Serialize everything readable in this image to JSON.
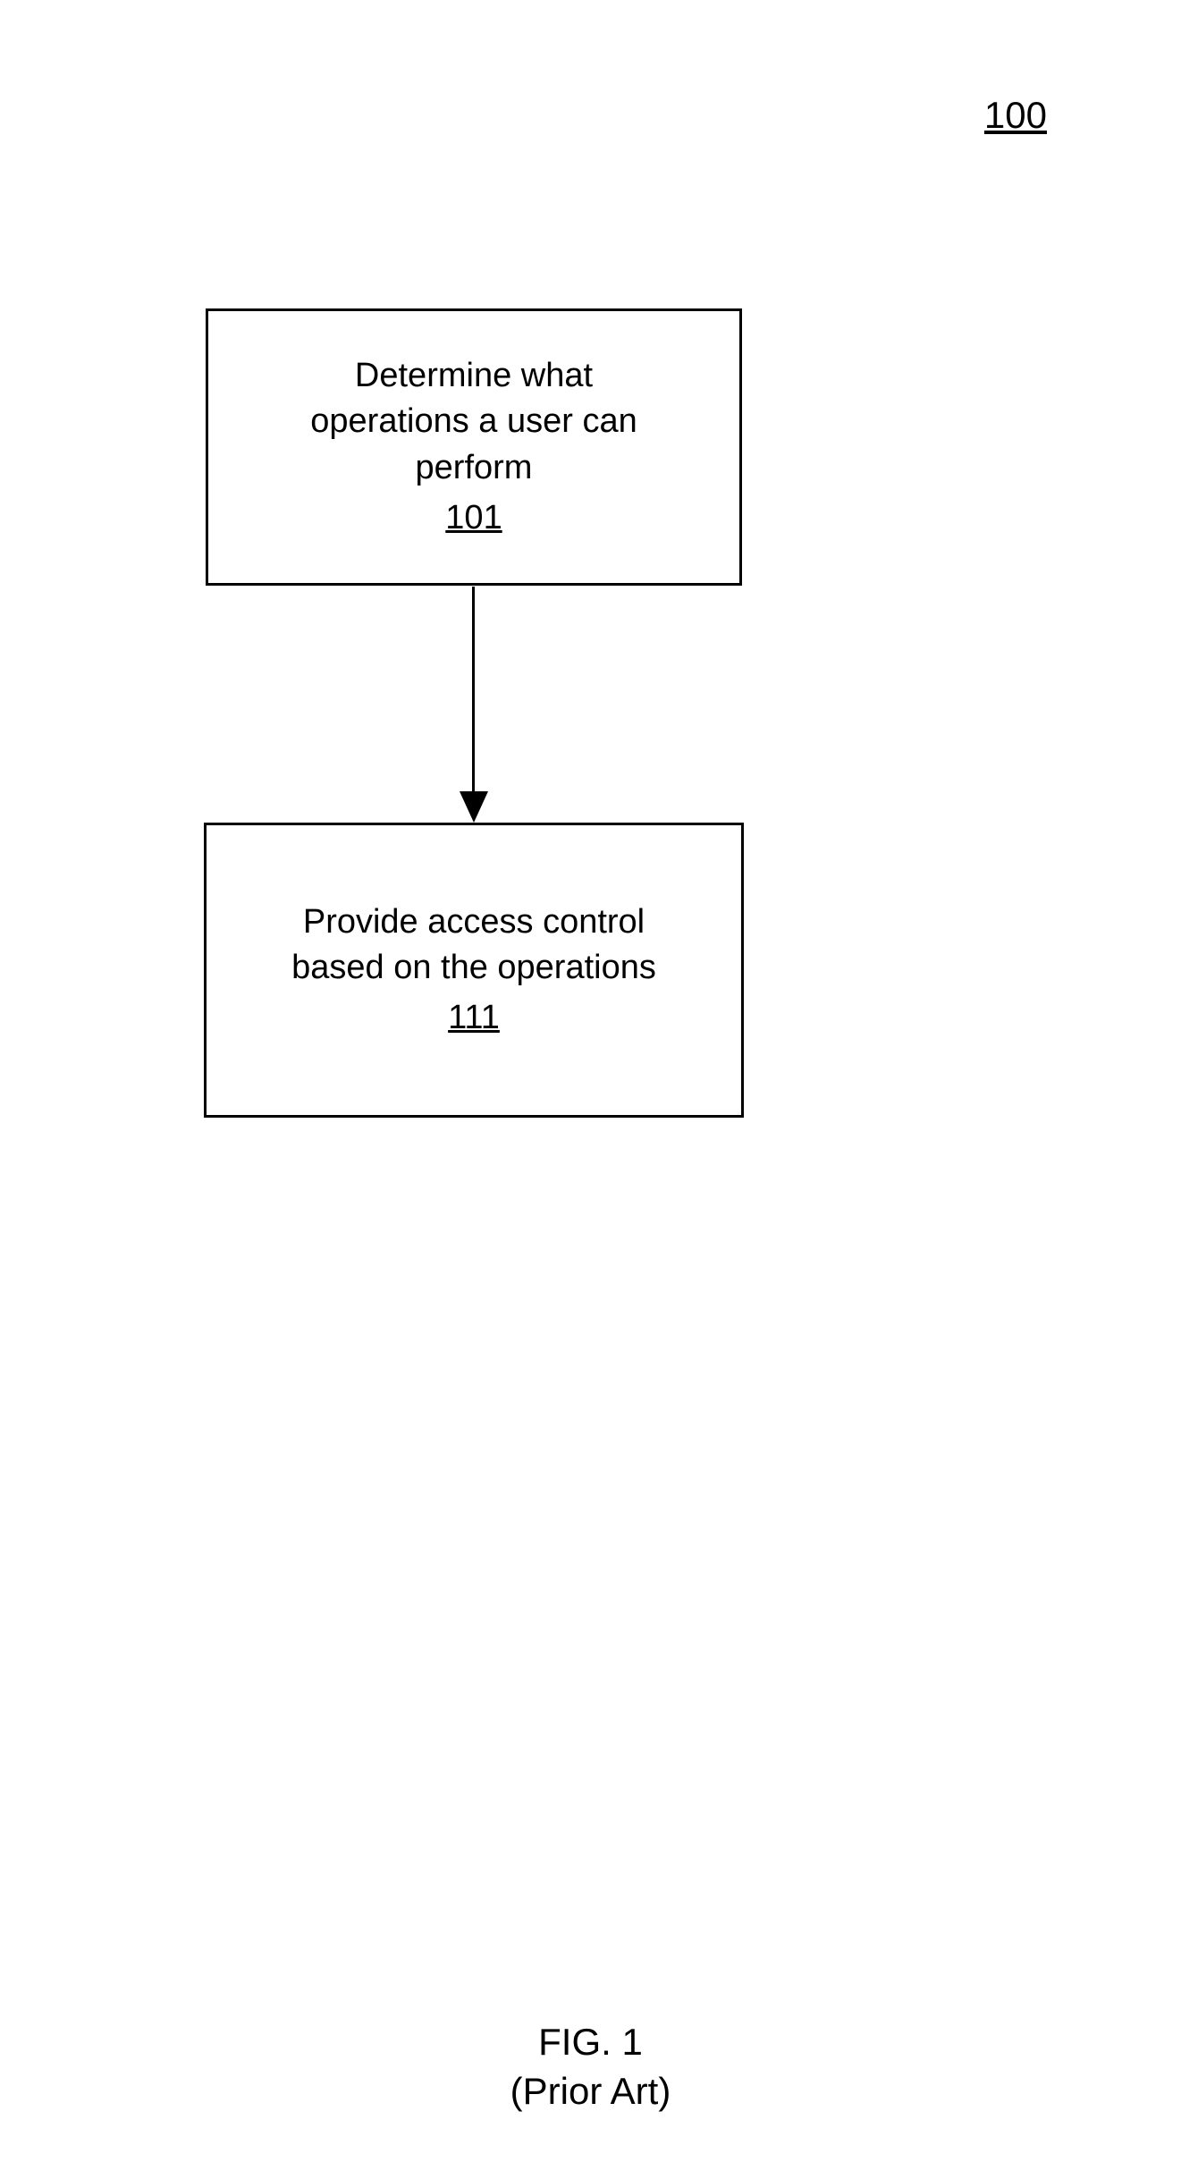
{
  "figure_number": "100",
  "box101": {
    "text": "Determine what\noperations a user can\nperform",
    "ref": "101"
  },
  "box111": {
    "text": "Provide access control\nbased on the operations",
    "ref": "111"
  },
  "caption": {
    "fig": "FIG. 1",
    "prior": "(Prior Art)"
  }
}
